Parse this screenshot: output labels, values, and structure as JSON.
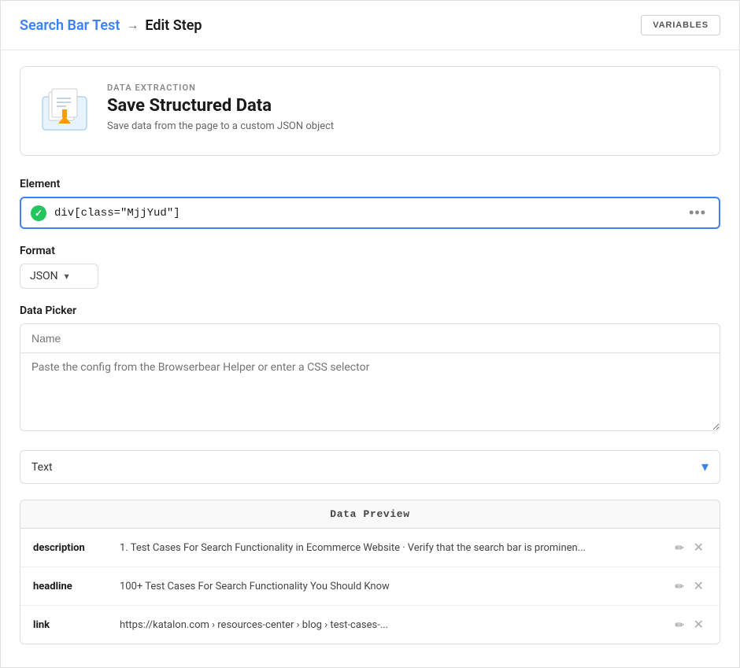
{
  "header": {
    "breadcrumb_link": "Search Bar Test",
    "arrow": "→",
    "current_page": "Edit Step",
    "variables_button": "VARIABLES"
  },
  "step_card": {
    "category": "DATA EXTRACTION",
    "title": "Save Structured Data",
    "description": "Save data from the page to a custom JSON object"
  },
  "element_section": {
    "label": "Element",
    "value": "div[class=\"MjjYud\"]",
    "more_icon": "•••"
  },
  "format_section": {
    "label": "Format",
    "selected": "JSON",
    "chevron": "▾"
  },
  "data_picker_section": {
    "label": "Data Picker",
    "name_placeholder": "Name",
    "config_placeholder": "Paste the config from the Browserbear Helper or enter a CSS selector"
  },
  "text_type_section": {
    "selected": "Text",
    "chevron": "▾"
  },
  "data_preview": {
    "header": "Data Preview",
    "rows": [
      {
        "key": "description",
        "value": "1. Test Cases For Search Functionality in Ecommerce Website · Verify that the search bar is prominen..."
      },
      {
        "key": "headline",
        "value": "100+ Test Cases For Search Functionality You Should Know"
      },
      {
        "key": "link",
        "value": "https://katalon.com › resources-center › blog › test-cases-..."
      }
    ]
  }
}
